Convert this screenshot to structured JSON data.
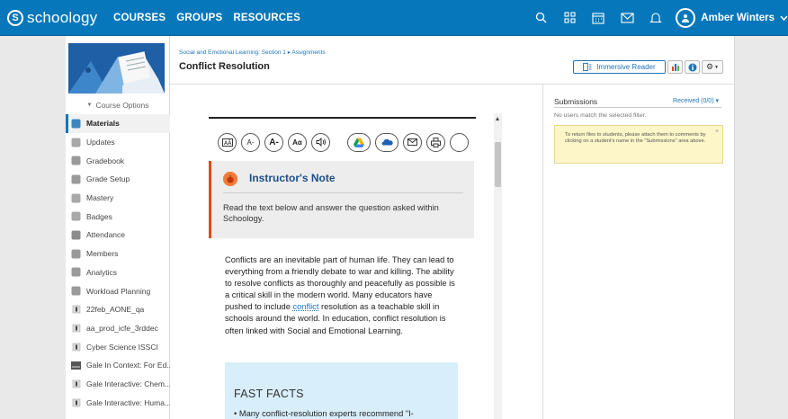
{
  "nav": {
    "logo_text": "schoology",
    "logo_mark": "S",
    "links": [
      "COURSES",
      "GROUPS",
      "RESOURCES"
    ],
    "user_name": "Amber Winters",
    "icons": [
      "search-icon",
      "grid-icon",
      "calendar-icon",
      "mail-icon",
      "bell-icon",
      "avatar-icon",
      "chevron-down-icon"
    ],
    "accent": "#0677ba"
  },
  "sidebar": {
    "course_options": "Course Options",
    "items": [
      {
        "label": "Materials",
        "icon": "materials-icon",
        "active": true
      },
      {
        "label": "Updates",
        "icon": "updates-icon"
      },
      {
        "label": "Gradebook",
        "icon": "gradebook-icon"
      },
      {
        "label": "Grade Setup",
        "icon": "grade-setup-icon"
      },
      {
        "label": "Mastery",
        "icon": "mastery-icon"
      },
      {
        "label": "Badges",
        "icon": "badges-icon"
      },
      {
        "label": "Attendance",
        "icon": "attendance-icon"
      },
      {
        "label": "Members",
        "icon": "members-icon"
      },
      {
        "label": "Analytics",
        "icon": "analytics-icon"
      },
      {
        "label": "Workload Planning",
        "icon": "workload-icon"
      },
      {
        "label": "22feb_AONE_qa",
        "icon": "app-icon"
      },
      {
        "label": "aa_prod_icfe_3rddec",
        "icon": "app-icon"
      },
      {
        "label": "Cyber Science ISSCI",
        "icon": "app-icon"
      },
      {
        "label": "Gale In Context: For Ed...",
        "icon": "gale-icon"
      },
      {
        "label": "Gale Interactive: Chem...",
        "icon": "app-icon"
      },
      {
        "label": "Gale Interactive: Huma...",
        "icon": "app-icon"
      }
    ]
  },
  "main": {
    "breadcrumb": "Social and Emotional Learning: Section 1 ▸ Assignments",
    "title": "Conflict Resolution",
    "immersive_reader": "Immersive Reader"
  },
  "submissions": {
    "title": "Submissions",
    "received": "Received (0/0) ▾",
    "empty": "No users match the selected filter.",
    "note": "To return files to students, please attach them to comments by clicking on a student's name in the \"Submissions\" area above.",
    "close": "×"
  },
  "content": {
    "toolbar": {
      "text_mode": "A̲Ā",
      "decrease": "A-",
      "increase": "A-",
      "font": "Aα",
      "audio": "🔊"
    },
    "instructor_title": "Instructor's Note",
    "instructor_text": "Read the text below and answer the question asked within Schoology.",
    "body_before": "Conflicts are an inevitable part of human life. They can lead to everything from a friendly debate to war and killing. The ability to resolve conflicts as thoroughly and peacefully as possible is a critical skill in the modern world. Many educators have pushed to include ",
    "body_link": "conflict",
    "body_after": " resolution as a teachable skill in schools around the world. In education, conflict resolution is often linked with Social and Emotional Learning.",
    "fast_facts_title": "FAST FACTS",
    "fast_facts_item": "• Many conflict-resolution experts recommend \"I-"
  }
}
